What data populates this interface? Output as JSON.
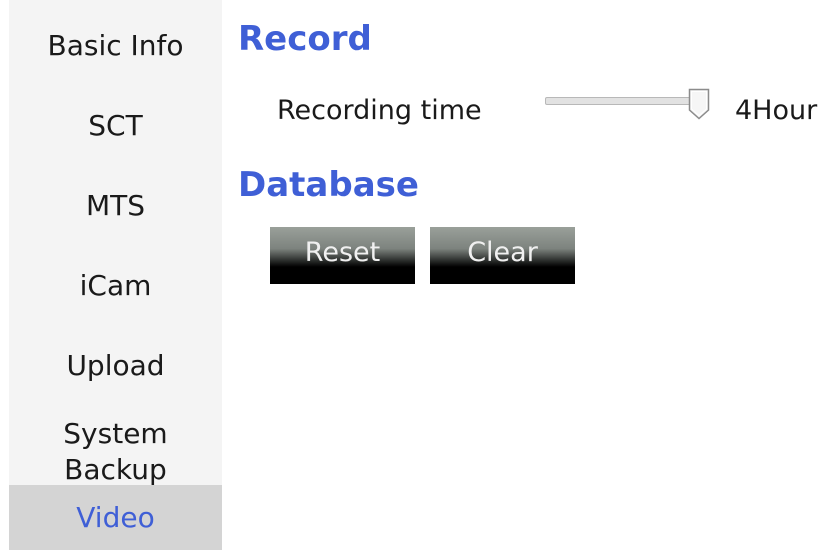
{
  "sidebar": {
    "items": [
      {
        "label": "Basic Info"
      },
      {
        "label": "SCT"
      },
      {
        "label": "MTS"
      },
      {
        "label": "iCam"
      },
      {
        "label": "Upload"
      },
      {
        "label_line1": "System",
        "label_line2": "Backup"
      },
      {
        "label": "Video",
        "active": true
      }
    ],
    "active_color": "#3f5fd6"
  },
  "record": {
    "title": "Record",
    "recording_time_label": "Recording time",
    "recording_time_value": "4Hour",
    "slider_fraction": 1.0
  },
  "database": {
    "title": "Database",
    "reset_label": "Reset",
    "clear_label": "Clear"
  },
  "colors": {
    "accent": "#3f5fd6",
    "sidebar_bg": "#f4f4f4",
    "active_bg": "#d4d4d4"
  }
}
